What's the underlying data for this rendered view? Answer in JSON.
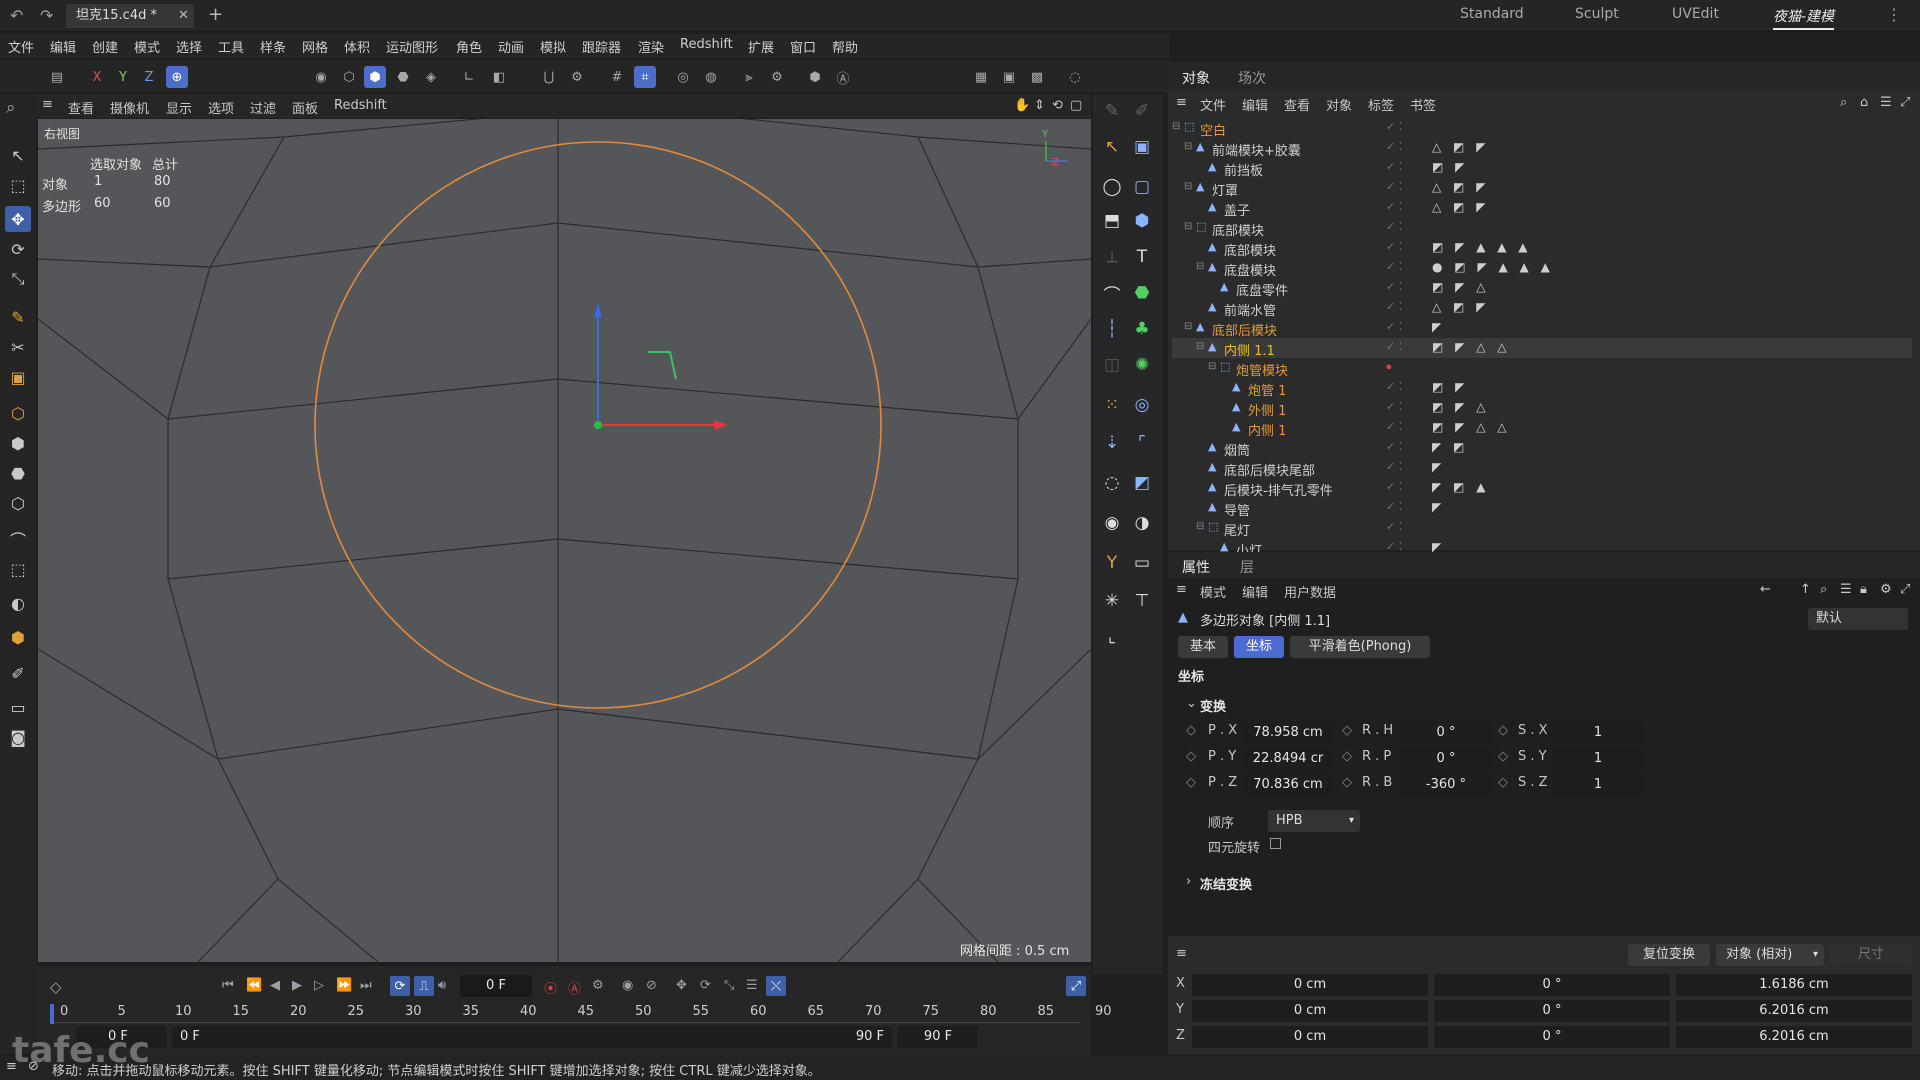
{
  "title_bar": {
    "tab_label": "坦克15.c4d *",
    "workspaces": [
      "Standard",
      "Sculpt",
      "UVEdit",
      "夜猫-建模"
    ]
  },
  "menu": [
    "文件",
    "编辑",
    "创建",
    "模式",
    "选择",
    "工具",
    "样条",
    "网格",
    "体积",
    "运动图形",
    "角色",
    "动画",
    "模拟",
    "跟踪器",
    "渲染",
    "Redshift",
    "扩展",
    "窗口",
    "帮助"
  ],
  "toolbar": {
    "axis_x": "X",
    "axis_y": "Y",
    "axis_z": "Z"
  },
  "viewport": {
    "menu": [
      "查看",
      "摄像机",
      "显示",
      "选项",
      "过滤",
      "面板",
      "Redshift"
    ],
    "view_name": "右视图",
    "stats_header": [
      "选取对象",
      "总计"
    ],
    "stats_rows": [
      [
        "对象",
        "1",
        "80"
      ],
      [
        "多边形",
        "60",
        "60"
      ]
    ],
    "grid_spacing": "网格间距 : 0.5 cm"
  },
  "object_manager": {
    "tabs": [
      "对象",
      "场次"
    ],
    "menu": [
      "文件",
      "编辑",
      "查看",
      "对象",
      "标签",
      "书签"
    ],
    "rows": [
      {
        "name": "空白",
        "color": "#e39a3a",
        "tags": ""
      },
      {
        "name": "前端模块+胶囊",
        "color": "#cfcfcf",
        "tags": "△ ◩ ◤"
      },
      {
        "name": "前挡板",
        "color": "#cfcfcf",
        "tags": "◩ ◤"
      },
      {
        "name": "灯罩",
        "color": "#cfcfcf",
        "tags": "△ ◩ ◤"
      },
      {
        "name": "盖子",
        "color": "#cfcfcf",
        "tags": "△ ◩ ◤"
      },
      {
        "name": "底部模块",
        "color": "#cfcfcf",
        "tags": ""
      },
      {
        "name": "底部模块",
        "color": "#cfcfcf",
        "tags": "◩ ◤ ▲ ▲ ▲"
      },
      {
        "name": "底盘模块",
        "color": "#cfcfcf",
        "tags": "● ◩ ◤ ▲ ▲ ▲"
      },
      {
        "name": "底盘零件",
        "color": "#cfcfcf",
        "tags": "◩ ◤ △"
      },
      {
        "name": "前端水管",
        "color": "#cfcfcf",
        "tags": "△ ◩ ◤"
      },
      {
        "name": "底部后模块",
        "color": "#e39a3a",
        "tags": "◤"
      },
      {
        "name": "内侧 1.1",
        "color": "#f0c020",
        "tags": "◩ ◤ △ △"
      },
      {
        "name": "炮管模块",
        "color": "#e39a3a",
        "tags": ""
      },
      {
        "name": "炮管 1",
        "color": "#e39a3a",
        "tags": "◩ ◤"
      },
      {
        "name": "外侧 1",
        "color": "#e39a3a",
        "tags": "◩ ◤ △"
      },
      {
        "name": "内侧 1",
        "color": "#e39a3a",
        "tags": "◩ ◤ △ △"
      },
      {
        "name": "烟筒",
        "color": "#cfcfcf",
        "tags": "◤ ◩"
      },
      {
        "name": "底部后模块尾部",
        "color": "#cfcfcf",
        "tags": "◤"
      },
      {
        "name": "后模块-排气孔零件",
        "color": "#cfcfcf",
        "tags": "◤ ◩ ▲"
      },
      {
        "name": "导管",
        "color": "#cfcfcf",
        "tags": "◤"
      },
      {
        "name": "尾灯",
        "color": "#cfcfcf",
        "tags": ""
      },
      {
        "name": "小灯",
        "color": "#cfcfcf",
        "tags": "◤"
      }
    ]
  },
  "attributes": {
    "tabs": [
      "属性",
      "层"
    ],
    "menu": [
      "模式",
      "编辑",
      "用户数据"
    ],
    "object_title": "多边形对象 [内侧 1.1]",
    "preset": "默认",
    "sub_tabs": [
      "基本",
      "坐标",
      "平滑着色(Phong)"
    ],
    "section": "坐标",
    "group": "变换",
    "labels": [
      "P . X",
      "P . Y",
      "P . Z",
      "R . H",
      "R . P",
      "R . B",
      "S . X",
      "S . Y",
      "S . Z"
    ],
    "values": [
      "78.958 cm",
      "22.8494 cr",
      "70.836 cm",
      "0 °",
      "0 °",
      "-360 °",
      "1",
      "1",
      "1"
    ],
    "order_label": "顺序",
    "order_value": "HPB",
    "quat_label": "四元旋转",
    "freeze": "冻结变换"
  },
  "coord_manager": {
    "reset_button": "复位变换",
    "mode": "对象 (相对)",
    "size_label": "尺寸",
    "axes": [
      "X",
      "Y",
      "Z"
    ],
    "position": [
      "0 cm",
      "0 cm",
      "0 cm"
    ],
    "rotation": [
      "0 °",
      "0 °",
      "0 °"
    ],
    "size": [
      "1.6186 cm",
      "6.2016 cm",
      "6.2016 cm"
    ]
  },
  "timeline": {
    "current_frame": "0 F",
    "ticks": [
      "0",
      "5",
      "10",
      "15",
      "20",
      "25",
      "30",
      "35",
      "40",
      "45",
      "50",
      "55",
      "60",
      "65",
      "70",
      "75",
      "80",
      "85",
      "90"
    ],
    "start_a": "0 F",
    "start_b": "0 F",
    "end_a": "90 F",
    "end_b": "90 F"
  },
  "status_bar": "移动: 点击并拖动鼠标移动元素。按住 SHIFT 键量化移动; 节点编辑模式时按住 SHIFT 键增加选择对象; 按住 CTRL 键减少选择对象。",
  "watermark": "tafe.cc"
}
